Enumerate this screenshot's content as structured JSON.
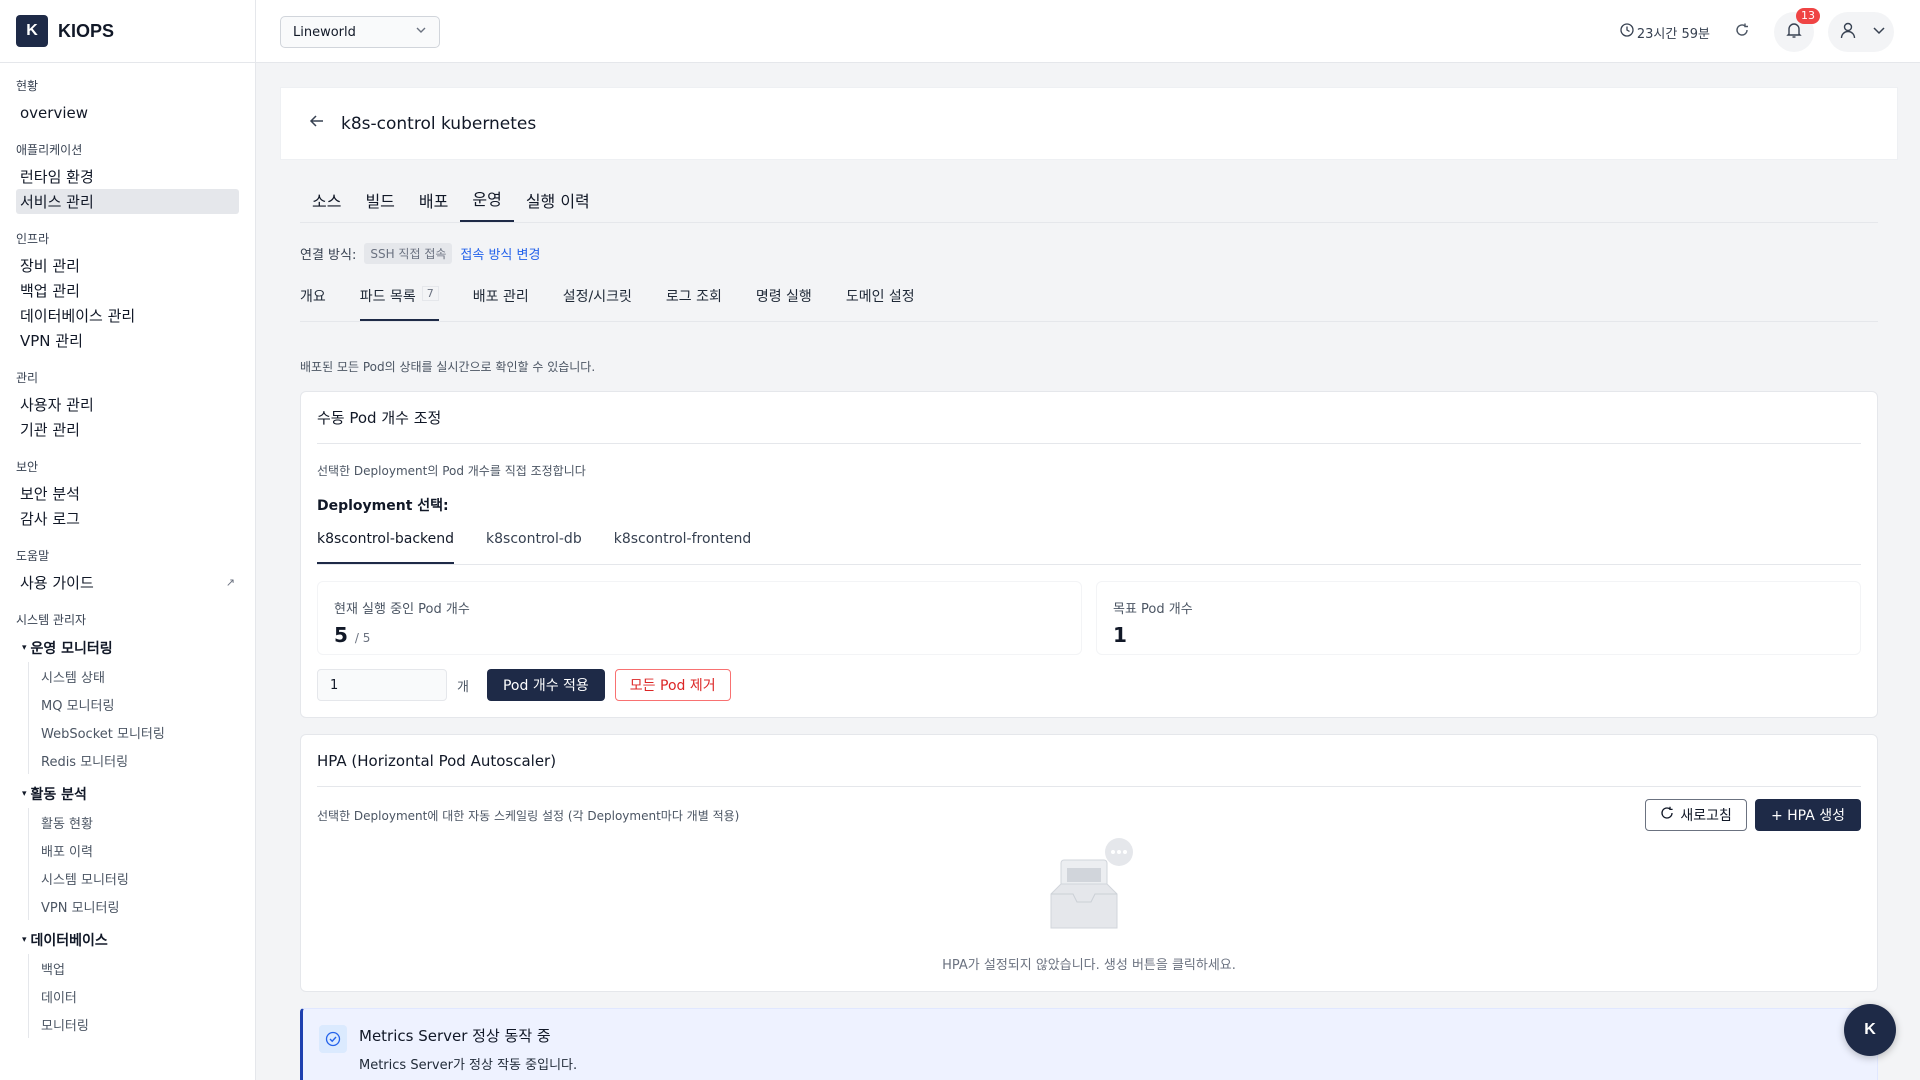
{
  "app": {
    "logo_letter": "K",
    "name": "KIOPS"
  },
  "sidebar": {
    "groups": [
      {
        "label": "현황",
        "items": [
          "overview"
        ]
      },
      {
        "label": "애플리케이션",
        "items": [
          "런타임 환경",
          "서비스 관리"
        ]
      },
      {
        "label": "인프라",
        "items": [
          "장비 관리",
          "백업 관리",
          "데이터베이스 관리",
          "VPN 관리"
        ]
      },
      {
        "label": "관리",
        "items": [
          "사용자 관리",
          "기관 관리"
        ]
      },
      {
        "label": "보안",
        "items": [
          "보안 분석",
          "감사 로그"
        ]
      },
      {
        "label": "도움말",
        "items": [
          "사용 가이드"
        ]
      }
    ],
    "external_icon": "↗",
    "admin_label": "시스템 관리자",
    "sections": [
      {
        "title": "운영 모니터링",
        "items": [
          "시스템 상태",
          "MQ 모니터링",
          "WebSocket 모니터링",
          "Redis 모니터링"
        ]
      },
      {
        "title": "활동 분석",
        "items": [
          "활동 현황",
          "배포 이력",
          "시스템 모니터링",
          "VPN 모니터링"
        ]
      },
      {
        "title": "데이터베이스",
        "items": [
          "백업",
          "데이터",
          "모니터링"
        ]
      }
    ],
    "active_item": "서비스 관리"
  },
  "topbar": {
    "project": "Lineworld",
    "session": "23시간 59분",
    "notifications": "13",
    "icons": {
      "clock": "clock-icon",
      "refresh": "refresh-icon",
      "bell": "bell-icon",
      "user": "user-icon"
    }
  },
  "page": {
    "title": "k8s-control kubernetes",
    "tabs": [
      "소스",
      "빌드",
      "배포",
      "운영",
      "실행 이력"
    ],
    "active_tab": "운영",
    "conn_label": "연결 방식:",
    "conn_chip": "SSH 직접 접속",
    "conn_link": "접속 방식 변경",
    "subtabs": [
      {
        "label": "개요"
      },
      {
        "label": "파드 목록",
        "count": "7"
      },
      {
        "label": "배포 관리"
      },
      {
        "label": "설정/시크릿"
      },
      {
        "label": "로그 조회"
      },
      {
        "label": "명령 실행"
      },
      {
        "label": "도메인 설정"
      }
    ],
    "description": "배포된 모든 Pod의 상태를 실시간으로 확인할 수 있습니다."
  },
  "scale_card": {
    "title": "수동 Pod 개수 조정",
    "subtitle": "선택한 Deployment의 Pod 개수를 직접 조정합니다",
    "dep_label": "Deployment 선택:",
    "deployments": [
      "k8scontrol-backend",
      "k8scontrol-db",
      "k8scontrol-frontend"
    ],
    "current_label": "현재 실행 중인 Pod 개수",
    "current_value": "5",
    "current_total": "/ 5",
    "target_label": "목표 Pod 개수",
    "target_value": "1",
    "input_value": "1",
    "unit": "개",
    "apply_button": "Pod 개수 적용",
    "remove_button": "모든 Pod 제거"
  },
  "hpa_card": {
    "title": "HPA (Horizontal Pod Autoscaler)",
    "subtitle": "선택한 Deployment에 대한 자동 스케일링 설정 (각 Deployment마다 개별 적용)",
    "refresh_button": "새로고침",
    "create_button": "+ HPA 생성",
    "empty_text": "HPA가 설정되지 않았습니다. 생성 버튼을 클릭하세요."
  },
  "alert": {
    "title": "Metrics Server 정상 동작 중",
    "body": "Metrics Server가 정상 작동 중입니다."
  },
  "fab": {
    "letter": "K"
  }
}
